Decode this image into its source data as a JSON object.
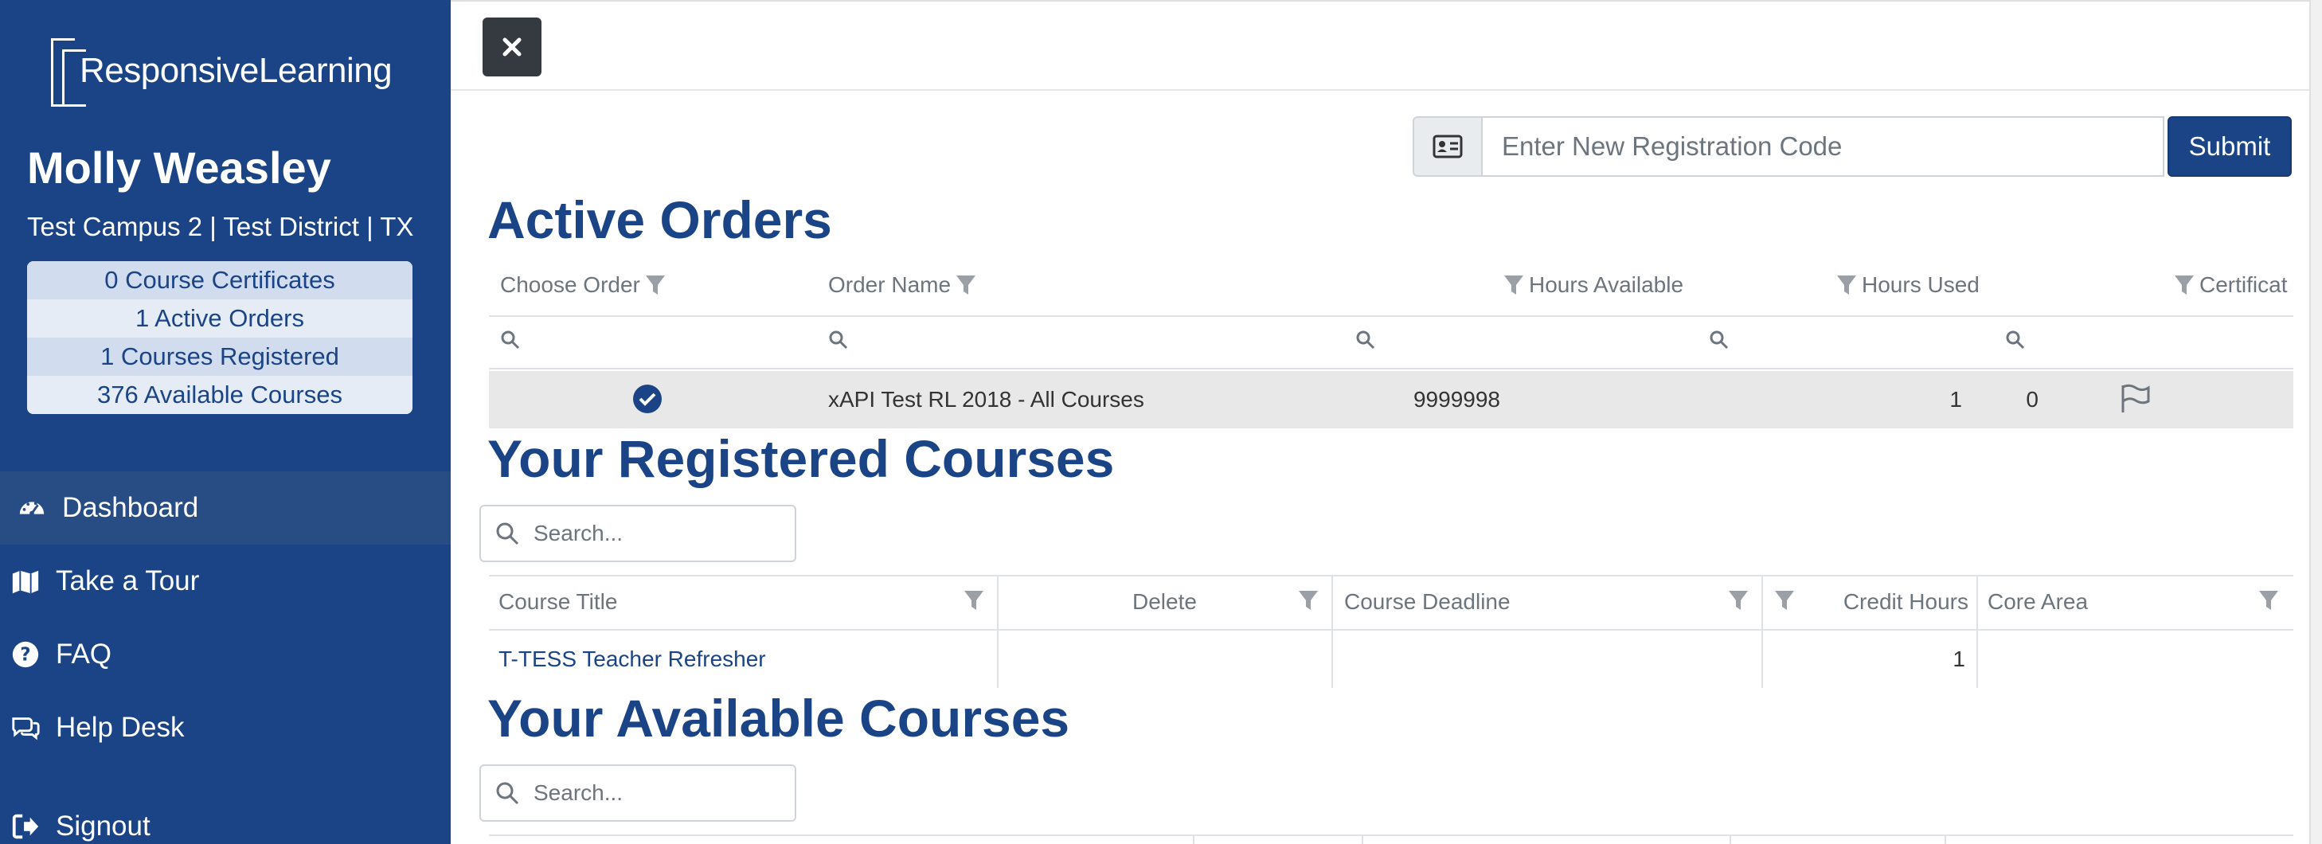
{
  "sidebar": {
    "logo_text": "ResponsiveLearning",
    "user_name": "Molly Weasley",
    "user_org": "Test Campus 2 | Test District | TX",
    "stats": [
      "0 Course Certificates",
      "1 Active Orders",
      "1 Courses Registered",
      "376 Available Courses"
    ],
    "nav": [
      {
        "label": "Dashboard",
        "icon": "dashboard-icon",
        "active": true
      },
      {
        "label": "Take a Tour",
        "icon": "map-icon"
      },
      {
        "label": "FAQ",
        "icon": "question-circle-icon"
      },
      {
        "label": "Help Desk",
        "icon": "comments-icon"
      },
      {
        "label": "Signout",
        "icon": "sign-out-icon"
      }
    ]
  },
  "registration": {
    "placeholder": "Enter New Registration Code",
    "submit_label": "Submit"
  },
  "active_orders": {
    "title": "Active Orders",
    "columns": [
      "Choose Order",
      "Order Name",
      "Hours Available",
      "Hours Used",
      "Certificat"
    ],
    "rows": [
      {
        "order_name": "xAPI Test RL 2018 - All Courses",
        "hours_available": "9999998",
        "hours_used": "1",
        "certificates": "0"
      }
    ]
  },
  "registered_courses": {
    "title": "Your Registered Courses",
    "search_placeholder": "Search...",
    "columns": [
      "Course Title",
      "Delete",
      "Course Deadline",
      "Credit Hours",
      "Core Area"
    ],
    "rows": [
      {
        "course_title": "T-TESS Teacher Refresher",
        "delete": "",
        "deadline": "",
        "credit_hours": "1",
        "core_area": ""
      }
    ]
  },
  "available_courses": {
    "title": "Your Available Courses",
    "search_placeholder": "Search..."
  },
  "colors": {
    "brand": "#1b4486",
    "sidebar_active": "#284d85",
    "close_button": "#343a40"
  }
}
